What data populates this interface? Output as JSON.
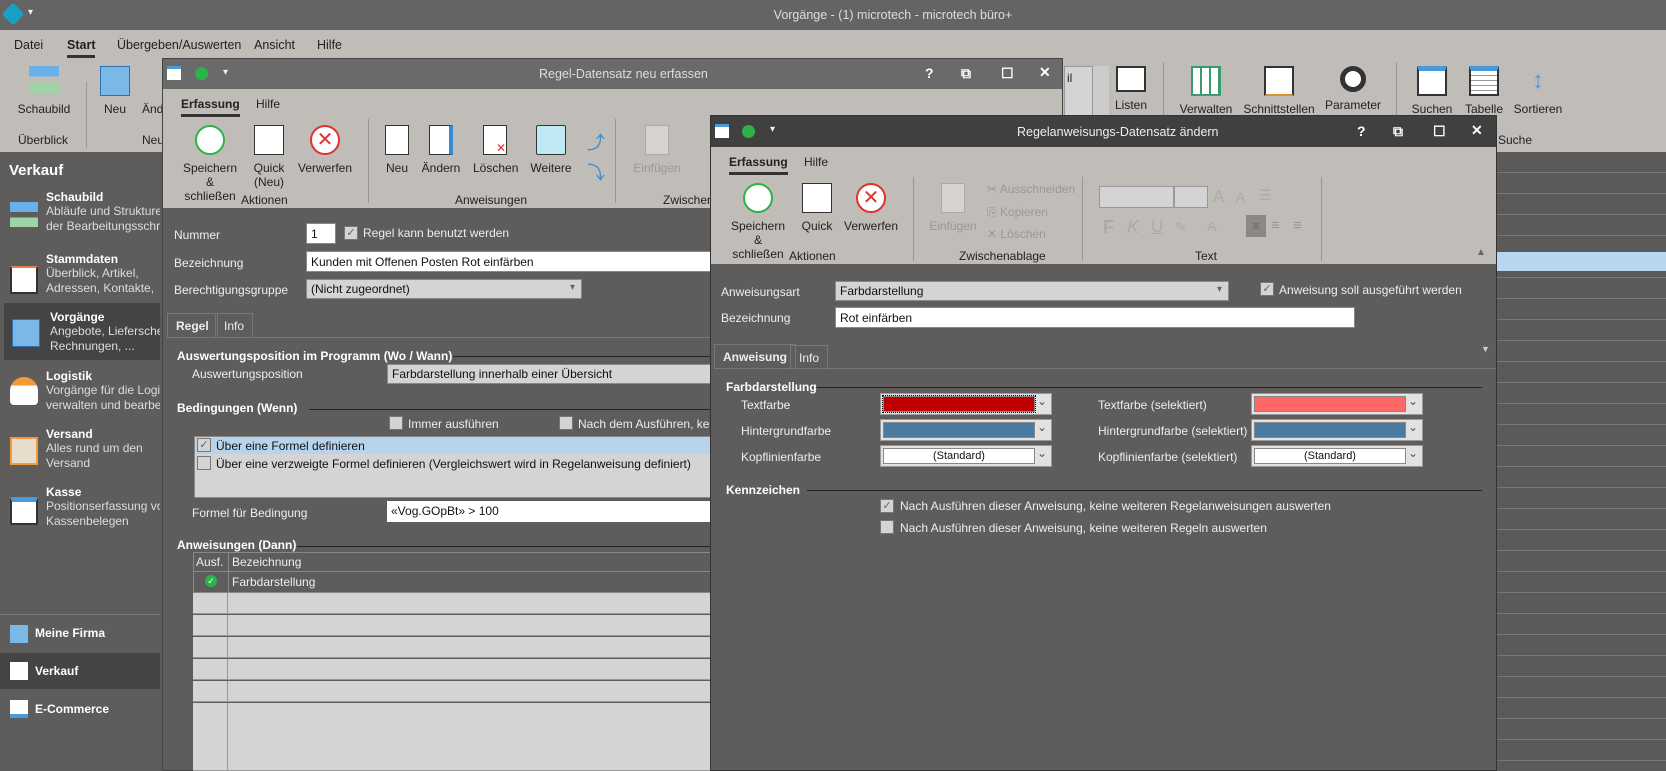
{
  "app": {
    "title": "Vorgänge - (1) microtech - microtech büro+",
    "logo_text": "microtech"
  },
  "menu": [
    "Datei",
    "Start",
    "Übergeben/Auswerten",
    "Ansicht",
    "Hilfe"
  ],
  "ribbon": {
    "schaubild": "Schaubild",
    "neu": "Neu",
    "aend": "Änd",
    "group_ueberblick": "Überblick",
    "group_neu": "Neu",
    "combo_text": "il",
    "listen": "Listen",
    "verwalten": "Verwalten",
    "schnittstellen": "Schnittstellen",
    "parameter": "Parameter",
    "suchen": "Suchen",
    "tabelle": "Tabelle",
    "sortieren": "Sortieren",
    "group_suche": "Suche"
  },
  "sidebar": {
    "header": "Verkauf",
    "items": [
      {
        "title": "Schaubild",
        "desc1": "Abläufe und Strukturen",
        "desc2": "der Bearbeitungsschritte"
      },
      {
        "title": "Stammdaten",
        "desc1": "Überblick, Artikel,",
        "desc2": "Adressen, Kontakte,"
      },
      {
        "title": "Vorgänge",
        "desc1": "Angebote, Lieferscheine,",
        "desc2": "Rechnungen, ..."
      },
      {
        "title": "Logistik",
        "desc1": "Vorgänge für die Logistik",
        "desc2": "verwalten und bearbeiten"
      },
      {
        "title": "Versand",
        "desc1": "Alles rund um den",
        "desc2": "Versand"
      },
      {
        "title": "Kasse",
        "desc1": "Positionserfassung von",
        "desc2": "Kassenbelegen"
      }
    ],
    "bottom": [
      "Meine Firma",
      "Verkauf",
      "E-Commerce"
    ]
  },
  "dlg1": {
    "title": "Regel-Datensatz neu erfassen",
    "tabs": [
      "Erfassung",
      "Hilfe"
    ],
    "buttons": {
      "save": "Speichern",
      "save2": "& schließen",
      "quick": "Quick",
      "quick2": "(Neu)",
      "discard": "Verwerfen",
      "neu": "Neu",
      "aendern": "Ändern",
      "loeschen": "Löschen",
      "weitere": "Weitere",
      "einfuegen": "Einfügen"
    },
    "groups": {
      "aktionen": "Aktionen",
      "anweisungen": "Anweisungen",
      "zwischen": "Zwischen"
    },
    "nummer_label": "Nummer",
    "nummer": "1",
    "regel_aktiv": "Regel kann benutzt werden",
    "bez_label": "Bezeichnung",
    "bez": "Kunden mit Offenen Posten Rot einfärben",
    "ber_label": "Berechtigungsgruppe",
    "ber": "(Nicht zugeordnet)",
    "ptabs": [
      "Regel",
      "Info"
    ],
    "sec_ausw": "Auswertungsposition im Programm (Wo / Wann)",
    "ausw_label": "Auswertungsposition",
    "ausw": "Farbdarstellung innerhalb einer Übersicht",
    "sec_bed": "Bedingungen (Wenn)",
    "immer": "Immer ausführen",
    "nach": "Nach dem Ausführen, kein",
    "opt1": "Über eine Formel definieren",
    "opt2": "Über eine verzweigte Formel definieren (Vergleichswert wird in Regelanweisung definiert)",
    "formel_label": "Formel für Bedingung",
    "formel": "«Vog.GOpBt» > 100",
    "sec_anw": "Anweisungen (Dann)",
    "cols": [
      "Ausf.",
      "Bezeichnung"
    ],
    "rows": [
      {
        "name": "Farbdarstellung",
        "active": true
      }
    ]
  },
  "dlg2": {
    "title": "Regelanweisungs-Datensatz ändern",
    "tabs": [
      "Erfassung",
      "Hilfe"
    ],
    "buttons": {
      "save": "Speichern",
      "save2": "& schließen",
      "quick": "Quick",
      "discard": "Verwerfen",
      "einfuegen": "Einfügen",
      "ausschneiden": "Ausschneiden",
      "kopieren": "Kopieren",
      "loeschen": "Löschen"
    },
    "groups": {
      "aktionen": "Aktionen",
      "zwischen": "Zwischenablage",
      "text": "Text"
    },
    "art_label": "Anweisungsart",
    "art": "Farbdarstellung",
    "ausf": "Anweisung soll ausgeführt werden",
    "bez_label": "Bezeichnung",
    "bez": "Rot einfärben",
    "ptabs": [
      "Anweisung",
      "Info"
    ],
    "sec_farb": "Farbdarstellung",
    "colors": [
      {
        "label": "Textfarbe",
        "value": "#c00000",
        "label_sel": "Textfarbe (selektiert)",
        "value_sel": "#ff6666"
      },
      {
        "label": "Hintergrundfarbe",
        "value": "#4a7aa0",
        "label_sel": "Hintergrundfarbe (selektiert)",
        "value_sel": "#4a7aa0"
      },
      {
        "label": "Kopflinienfarbe",
        "value": "#ffffff",
        "text": "(Standard)",
        "label_sel": "Kopflinienfarbe (selektiert)",
        "value_sel": "#ffffff",
        "text_sel": "(Standard)"
      }
    ],
    "sec_kenn": "Kennzeichen",
    "k1": "Nach Ausführen dieser Anweisung, keine weiteren Regelanweisungen auswerten",
    "k1_checked": true,
    "k2": "Nach Ausführen dieser Anweisung, keine weiteren Regeln auswerten",
    "k2_checked": false
  }
}
